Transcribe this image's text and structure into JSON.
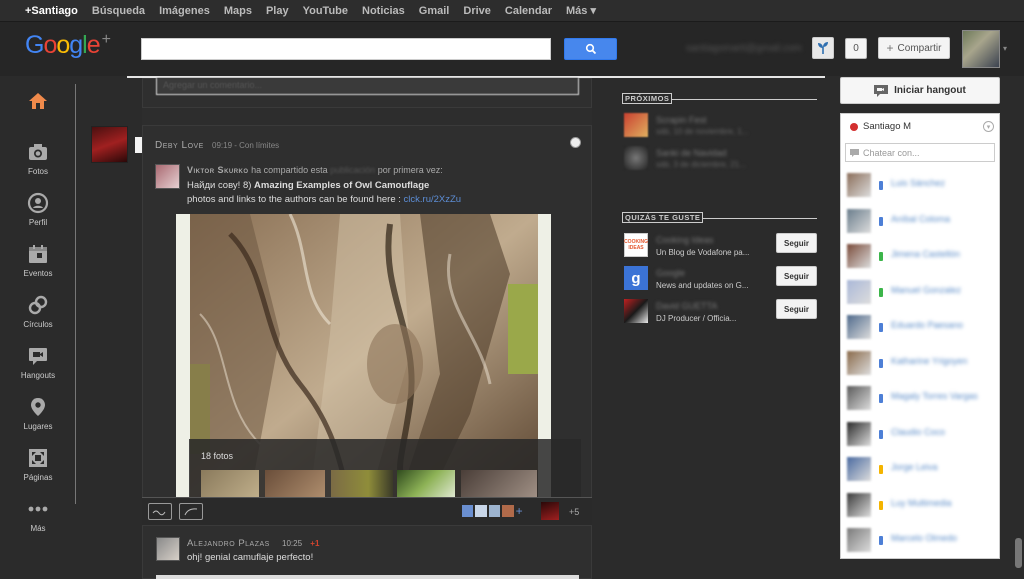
{
  "topbar": {
    "items": [
      "+Santiago",
      "Búsqueda",
      "Imágenes",
      "Maps",
      "Play",
      "YouTube",
      "Noticias",
      "Gmail",
      "Drive",
      "Calendar",
      "Más ▾"
    ]
  },
  "header": {
    "search_placeholder": "",
    "email": "santiagomarti@gmail.com",
    "notification_count": "0",
    "share_label": "Compartir"
  },
  "leftnav": {
    "items": [
      {
        "label": "",
        "icon": "home-icon"
      },
      {
        "label": "Fotos",
        "icon": "camera-icon"
      },
      {
        "label": "Perfil",
        "icon": "profile-icon"
      },
      {
        "label": "Eventos",
        "icon": "calendar-icon"
      },
      {
        "label": "Círculos",
        "icon": "circles-icon"
      },
      {
        "label": "Hangouts",
        "icon": "hangouts-icon"
      },
      {
        "label": "Lugares",
        "icon": "places-icon"
      },
      {
        "label": "Páginas",
        "icon": "pages-icon"
      },
      {
        "label": "Más",
        "icon": "more-icon"
      }
    ]
  },
  "stream": {
    "top_comment_placeholder": "Agregar un comentario...",
    "post": {
      "author": "Deby Love",
      "time": "09:19",
      "visibility": "Con límites",
      "sharer": "Viktor Skurko",
      "shared_text_pre": "ha compartido esta",
      "shared_word": "publicación",
      "shared_text_post": "por primera vez:",
      "title_prefix": "Найди сову! 8)",
      "title_bold": "Amazing Examples of Owl Camouflage",
      "link_text_pre": "photos and links to the authors can be found here :",
      "link": "clck.ru/2XzZu",
      "album_count": "18 fotos",
      "plus_count": "+5"
    },
    "comment": {
      "author": "Alejandro Plazas",
      "time": "10:25",
      "plus": "+1",
      "text": "ohj! genial camuflaje perfecto!"
    }
  },
  "right": {
    "upcoming_title": "PRÓXIMOS",
    "upcoming": [
      {
        "name": "Scrapin Fest",
        "date": "sáb, 10 de noviembre, 1..."
      },
      {
        "name": "Sanki de Navidad",
        "date": "sáb, 3 de diciembre, 21..."
      }
    ],
    "suggest_title": "QUIZÁS TE GUSTE",
    "suggestions": [
      {
        "name": "Cooking Ideas",
        "desc": "Un Blog de Vodafone pa..."
      },
      {
        "name": "Google",
        "desc": "News and updates on G..."
      },
      {
        "name": "David GUETTA",
        "desc": "DJ Producer / Officia..."
      }
    ],
    "follow_label": "Seguir"
  },
  "chat": {
    "hangout_label": "Iniciar hangout",
    "user": "Santiago M",
    "search_placeholder": "Chatear con...",
    "contacts": [
      {
        "name": "Luis Sánchez",
        "status": "#4d7fd6"
      },
      {
        "name": "Aníbal Coloma",
        "status": "#4d7fd6"
      },
      {
        "name": "Jimena Castellón",
        "status": "#3cb54a"
      },
      {
        "name": "Manuel Gonzalez",
        "status": "#3cb54a"
      },
      {
        "name": "Eduardo Paesano",
        "status": "#4d7fd6"
      },
      {
        "name": "Katharine Yrigoyen",
        "status": "#4d7fd6"
      },
      {
        "name": "Magaly Torres Vargas",
        "status": "#4d7fd6"
      },
      {
        "name": "Claudio Coco",
        "status": "#4d7fd6"
      },
      {
        "name": "Jorge Leiva",
        "status": "#f4b400"
      },
      {
        "name": "Luy Multimedia",
        "status": "#f4b400"
      },
      {
        "name": "Marcelo Olmedo",
        "status": "#4d7fd6"
      }
    ]
  }
}
